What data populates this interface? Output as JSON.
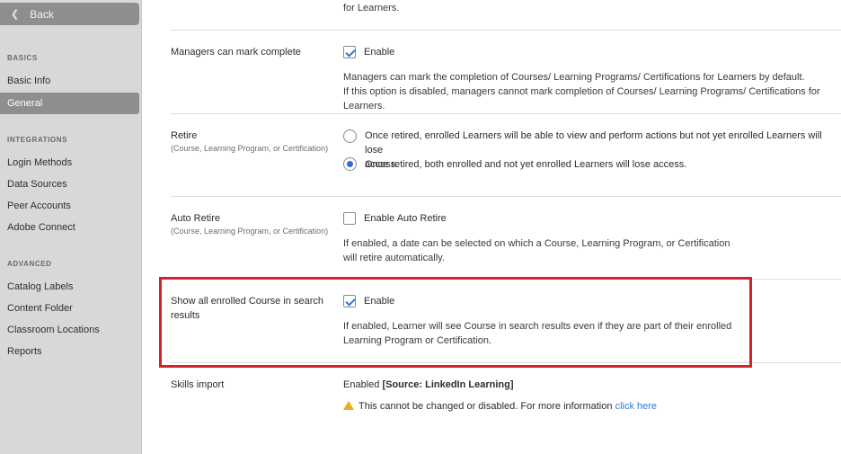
{
  "sidebar": {
    "back_label": "Back",
    "sections": [
      {
        "title": "BASICS",
        "items": [
          "Basic Info",
          "General"
        ]
      },
      {
        "title": "INTEGRATIONS",
        "items": [
          "Login Methods",
          "Data Sources",
          "Peer Accounts",
          "Adobe Connect"
        ]
      },
      {
        "title": "ADVANCED",
        "items": [
          "Catalog Labels",
          "Content Folder",
          "Classroom Locations",
          "Reports"
        ]
      }
    ],
    "active_item": "General"
  },
  "settings": {
    "top_clip_text": "for Learners.",
    "managers_complete": {
      "label": "Managers can mark complete",
      "checkbox_label": "Enable",
      "checked": true,
      "desc_line1": "Managers can mark the completion of Courses/ Learning Programs/ Certifications for Learners by default.",
      "desc_line2": "If this option is disabled, managers cannot mark completion of Courses/ Learning Programs/ Certifications for Learners."
    },
    "retire": {
      "label": "Retire",
      "sublabel": "(Course, Learning Program, or Certification)",
      "option1_line1": "Once retired, enrolled Learners will be able to view and perform actions but not yet enrolled Learners will lose",
      "option1_line2": "access.",
      "option2": "Once retired, both enrolled and not yet enrolled Learners will lose access.",
      "selected": 2
    },
    "auto_retire": {
      "label": "Auto Retire",
      "sublabel": "(Course, Learning Program, or Certification)",
      "checkbox_label": "Enable Auto Retire",
      "checked": false,
      "desc_line1": "If enabled, a date can be selected on which a Course, Learning Program, or Certification",
      "desc_line2": "will retire automatically."
    },
    "show_enrolled": {
      "label_line1": "Show all enrolled Course in search",
      "label_line2": "results",
      "checkbox_label": "Enable",
      "checked": true,
      "desc_line1": "If enabled, Learner will see Course in search results even if they are part of their enrolled",
      "desc_line2": "Learning Program or Certification."
    },
    "skills_import": {
      "label": "Skills import",
      "status": "Enabled",
      "source": "[Source: LinkedIn Learning]",
      "warning": "This cannot be changed or disabled. For more information",
      "link_text": "click here"
    }
  },
  "colors": {
    "highlight_border": "#d7212a",
    "check_color": "#3575c8",
    "link_color": "#2f7dd1",
    "warning_color": "#f0a920"
  }
}
